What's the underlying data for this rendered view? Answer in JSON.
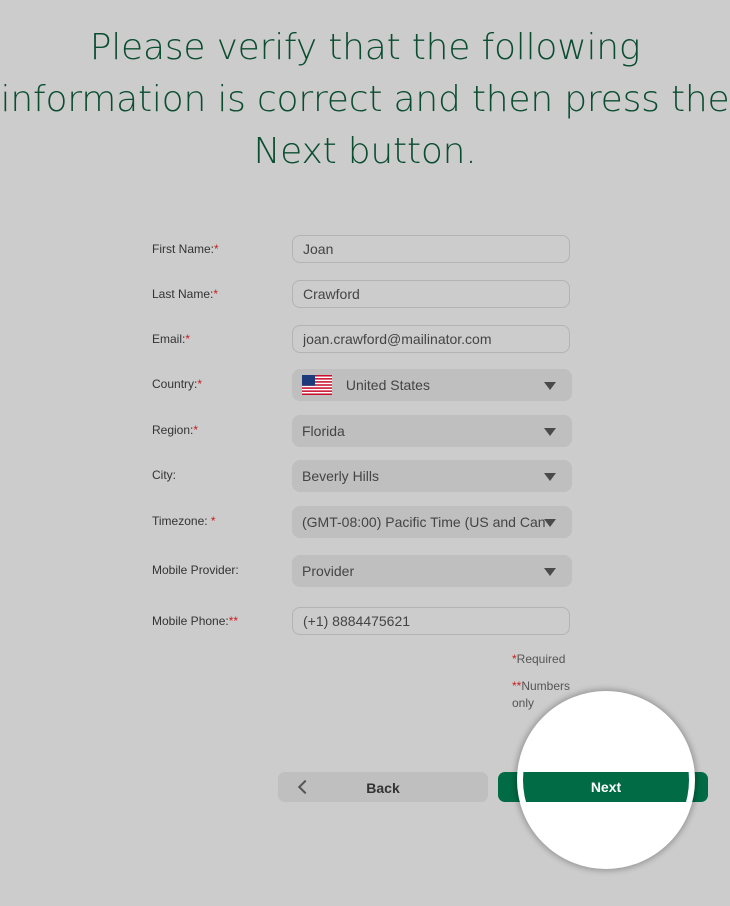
{
  "heading": {
    "line1": "Please verify that the following",
    "line2": "information is correct and then press the",
    "line3": "Next button."
  },
  "form": {
    "first_name": {
      "label": "First Name:",
      "marker": "*",
      "value": "Joan"
    },
    "last_name": {
      "label": "Last Name:",
      "marker": "*",
      "value": "Crawford"
    },
    "email": {
      "label": "Email:",
      "marker": "*",
      "value": "joan.crawford@mailinator.com"
    },
    "country": {
      "label": "Country:",
      "marker": "*",
      "value": "United States",
      "icon": "us-flag-icon"
    },
    "region": {
      "label": "Region:",
      "marker": "*",
      "value": "Florida"
    },
    "city": {
      "label": "City:",
      "value": "Beverly Hills"
    },
    "timezone": {
      "label": "Timezone: ",
      "marker": "*",
      "value": "(GMT-08:00) Pacific Time (US and Can"
    },
    "mobile_provider": {
      "label": "Mobile Provider:",
      "value": "Provider"
    },
    "mobile_phone": {
      "label": "Mobile Phone:",
      "marker": "**",
      "value": "(+1) 8884475621"
    }
  },
  "notes": {
    "required_marker": "*",
    "required_text": "Required",
    "numbers_marker": "**",
    "numbers_text_1": "Numbers",
    "numbers_text_2": "only"
  },
  "buttons": {
    "back": "Back",
    "next": "Next"
  },
  "colors": {
    "background": "#cccccc",
    "heading": "#0b4d31",
    "required": "#c81e1e",
    "next_button": "#006b45",
    "field": "#bfbfbf"
  }
}
